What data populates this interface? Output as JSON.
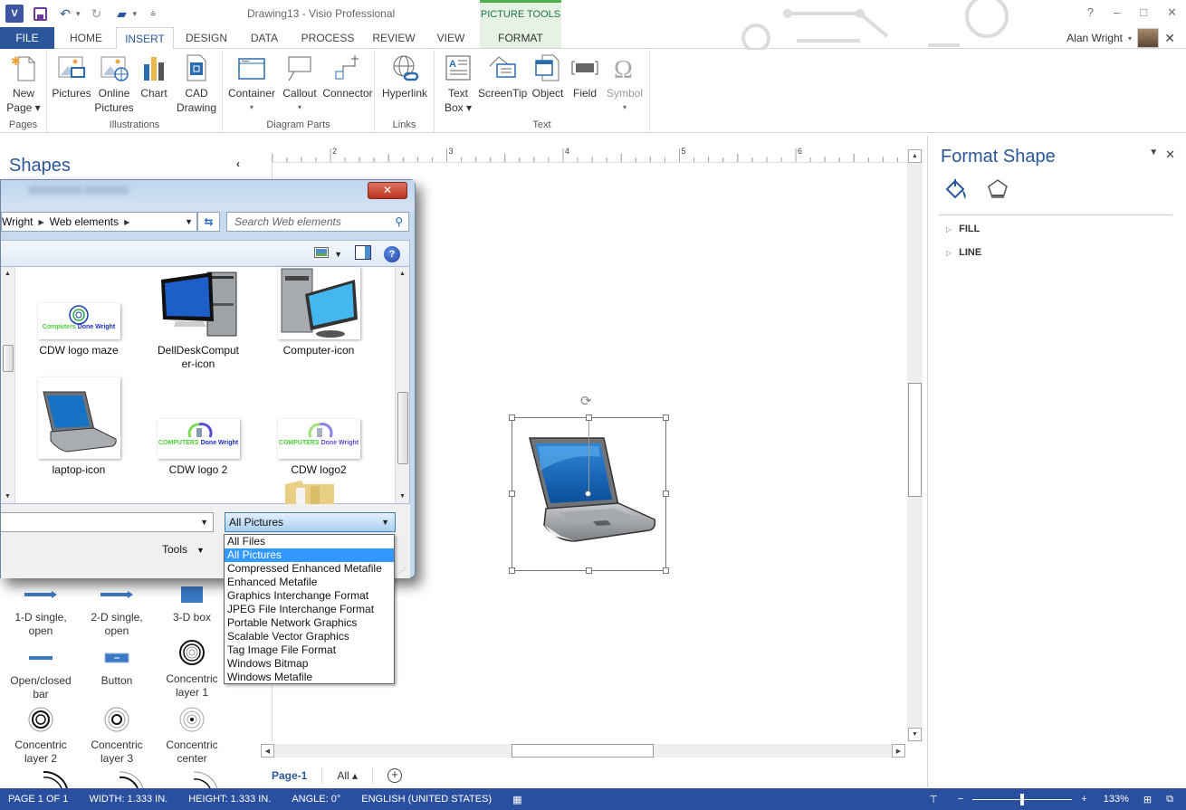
{
  "app": {
    "window_title": "Drawing13 - Visio Professional",
    "contextual_tab_group": "PICTURE TOOLS",
    "window_controls": [
      "?",
      "–",
      "□",
      "✕"
    ],
    "user_name": "Alan Wright"
  },
  "tabs": [
    {
      "label": "FILE",
      "active": false
    },
    {
      "label": "HOME",
      "active": false
    },
    {
      "label": "INSERT",
      "active": true
    },
    {
      "label": "DESIGN",
      "active": false
    },
    {
      "label": "DATA",
      "active": false
    },
    {
      "label": "PROCESS",
      "active": false
    },
    {
      "label": "REVIEW",
      "active": false
    },
    {
      "label": "VIEW",
      "active": false
    },
    {
      "label": "FORMAT",
      "active": false
    }
  ],
  "ribbon": {
    "groups": [
      {
        "label": "Pages",
        "buttons": [
          {
            "label1": "New",
            "label2": "Page ▾",
            "icon": "new-page-icon"
          }
        ]
      },
      {
        "label": "Illustrations",
        "buttons": [
          {
            "label1": "Pictures",
            "label2": "",
            "icon": "pictures-icon"
          },
          {
            "label1": "Online",
            "label2": "Pictures",
            "icon": "online-pictures-icon"
          },
          {
            "label1": "Chart",
            "label2": "",
            "icon": "chart-icon"
          },
          {
            "label1": "CAD",
            "label2": "Drawing",
            "icon": "cad-drawing-icon"
          }
        ]
      },
      {
        "label": "Diagram Parts",
        "buttons": [
          {
            "label1": "Container",
            "label2": "▾",
            "icon": "container-icon"
          },
          {
            "label1": "Callout",
            "label2": "▾",
            "icon": "callout-icon"
          },
          {
            "label1": "Connector",
            "label2": "",
            "icon": "connector-icon"
          }
        ]
      },
      {
        "label": "Links",
        "buttons": [
          {
            "label1": "Hyperlink",
            "label2": "",
            "icon": "hyperlink-icon"
          }
        ]
      },
      {
        "label": "Text",
        "buttons": [
          {
            "label1": "Text",
            "label2": "Box ▾",
            "icon": "text-box-icon"
          },
          {
            "label1": "ScreenTip",
            "label2": "",
            "icon": "screentip-icon"
          },
          {
            "label1": "Object",
            "label2": "",
            "icon": "object-icon"
          },
          {
            "label1": "Field",
            "label2": "",
            "icon": "field-icon"
          },
          {
            "label1": "Symbol",
            "label2": "▾",
            "icon": "symbol-icon",
            "disabled": true
          }
        ]
      }
    ]
  },
  "shapes_panel": {
    "title": "Shapes",
    "stencils": [
      {
        "label": "1-D single, open",
        "l1": "1-D single,",
        "l2": "open"
      },
      {
        "label": "2-D single, open",
        "l1": "2-D single,",
        "l2": "open"
      },
      {
        "label": "3-D box",
        "l1": "3-D box",
        "l2": ""
      },
      {
        "label": "Open/closed bar",
        "l1": "Open/closed",
        "l2": "bar"
      },
      {
        "label": "Button",
        "l1": "Button",
        "l2": ""
      },
      {
        "label": "Concentric layer 1",
        "l1": "Concentric",
        "l2": "layer 1"
      },
      {
        "label": "Concentric layer 2",
        "l1": "Concentric",
        "l2": "layer 2"
      },
      {
        "label": "Concentric layer 3",
        "l1": "Concentric",
        "l2": "layer 3"
      },
      {
        "label": "Concentric center",
        "l1": "Concentric",
        "l2": "center"
      }
    ]
  },
  "ruler": {
    "labels": [
      "2",
      "3",
      "4",
      "5",
      "6"
    ]
  },
  "page_tabs": {
    "page": "Page-1",
    "all": "All ▴",
    "add": "+"
  },
  "format_panel": {
    "title": "Format Shape",
    "sections": [
      "FILL",
      "LINE"
    ]
  },
  "status_bar": {
    "page": "PAGE 1 OF 1",
    "width": "WIDTH: 1.333 IN.",
    "height": "HEIGHT: 1.333 IN.",
    "angle": "ANGLE: 0°",
    "language": "ENGLISH (UNITED STATES)",
    "zoom": "133%",
    "zoom_slider_fraction": 0.5
  },
  "file_dialog": {
    "breadcrumb": [
      "Wright",
      "Web elements"
    ],
    "search_placeholder": "Search Web elements",
    "files": [
      {
        "name": "CDW logo maze",
        "name_l1": "CDW logo maze",
        "name_l2": "",
        "kind": "logo-maze"
      },
      {
        "name": "DellDeskComputer-icon",
        "name_l1": "DellDeskComput",
        "name_l2": "er-icon",
        "kind": "desktop"
      },
      {
        "name": "Computer-icon",
        "name_l1": "Computer-icon",
        "name_l2": "",
        "kind": "computer"
      },
      {
        "name": "laptop-icon",
        "name_l1": "laptop-icon",
        "name_l2": "",
        "kind": "laptop"
      },
      {
        "name": "CDW logo 2",
        "name_l1": "CDW logo 2",
        "name_l2": "",
        "kind": "logo"
      },
      {
        "name": "CDW logo2",
        "name_l1": "CDW logo2",
        "name_l2": "",
        "kind": "logo"
      }
    ],
    "logo_text_green": "COMPUTERS",
    "logo_text_blue": "Done Wright",
    "logo_maze_green": "Computers",
    "filename_value": "",
    "filetype_selected": "All Pictures",
    "tools_label": "Tools",
    "filetype_options": [
      "All Files",
      "All Pictures",
      "Compressed Enhanced Metafile",
      "Enhanced Metafile",
      "Graphics Interchange Format",
      "JPEG File Interchange Format",
      "Portable Network Graphics",
      "Scalable Vector Graphics",
      "Tag Image File Format",
      "Windows Bitmap",
      "Windows Metafile"
    ],
    "filetype_selected_index": 1
  },
  "colors": {
    "accent": "#2b579a",
    "status_bar": "#2b4f9f",
    "contextual_tab": "#e6f2e3",
    "dropdown_highlight": "#3399ff"
  }
}
